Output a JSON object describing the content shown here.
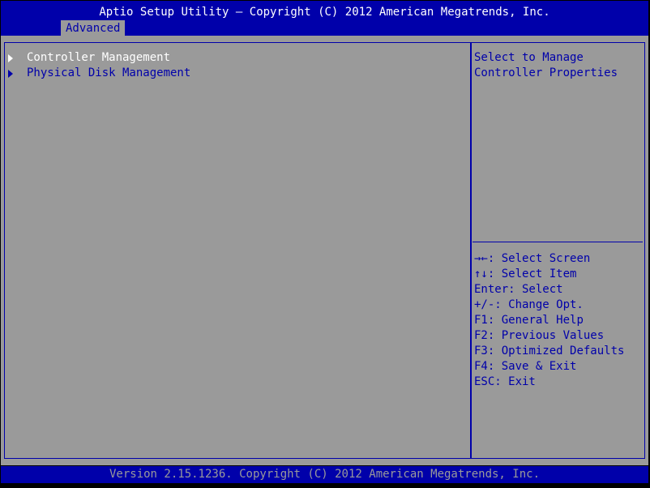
{
  "header": {
    "title": "Aptio Setup Utility – Copyright (C) 2012 American Megatrends, Inc.",
    "tabs": [
      {
        "label": "Advanced",
        "active": true
      }
    ]
  },
  "menu": {
    "items": [
      {
        "label": "Controller Management",
        "selected": true
      },
      {
        "label": "Physical Disk Management",
        "selected": false
      }
    ]
  },
  "help": {
    "line1": "Select to Manage",
    "line2": "Controller Properties"
  },
  "keys": [
    {
      "keys": "→←:",
      "action": " Select Screen"
    },
    {
      "keys": "↑↓:",
      "action": " Select Item"
    },
    {
      "keys": "Enter:",
      "action": " Select"
    },
    {
      "keys": "+/-:",
      "action": " Change Opt."
    },
    {
      "keys": "F1:",
      "action": " General Help"
    },
    {
      "keys": "F2:",
      "action": " Previous Values"
    },
    {
      "keys": "F3:",
      "action": " Optimized Defaults"
    },
    {
      "keys": "F4:",
      "action": " Save & Exit"
    },
    {
      "keys": "ESC:",
      "action": " Exit"
    }
  ],
  "footer": {
    "text": "Version 2.15.1236. Copyright (C) 2012 American Megatrends, Inc."
  },
  "colors": {
    "bar_blue": "#0000aa",
    "panel_gray": "#9a9a9a",
    "highlight_white": "#ffffff"
  }
}
